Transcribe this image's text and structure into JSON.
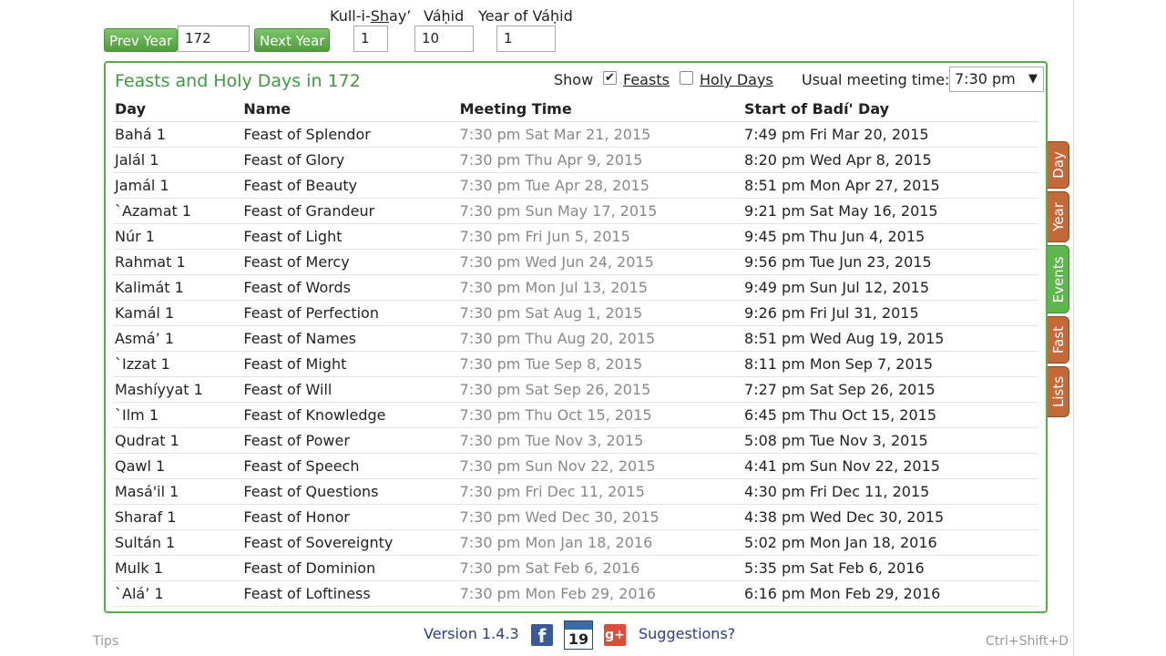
{
  "controls": {
    "prev_year_label": "Prev Year",
    "year_value": "172",
    "next_year_label": "Next Year",
    "kulli_shay_label_a": "Kull-i-",
    "kulli_shay_label_b": "Sh",
    "kulli_shay_label_c": "ay’",
    "kulli_shay_value": "1",
    "vahid_label": "Váḥid",
    "vahid_value": "10",
    "year_of_vahid_label": "Year of Váḥid",
    "year_of_vahid_value": "1"
  },
  "panel": {
    "title": "Feasts and Holy Days in 172",
    "show_label": "Show",
    "feasts_label": "Feasts",
    "feasts_checked": true,
    "holy_days_label": "Holy Days",
    "holy_days_checked": false,
    "meeting_time_label": "Usual meeting time:",
    "meeting_time_value": "7:30 pm"
  },
  "table": {
    "headers": [
      "Day",
      "Name",
      "Meeting Time",
      "Start of Badí' Day"
    ],
    "rows": [
      [
        "Bahá 1",
        "Feast of Splendor",
        "7:30 pm Sat Mar 21, 2015",
        "7:49 pm Fri Mar 20, 2015"
      ],
      [
        "Jalál 1",
        "Feast of Glory",
        "7:30 pm Thu Apr 9, 2015",
        "8:20 pm Wed Apr 8, 2015"
      ],
      [
        "Jamál 1",
        "Feast of Beauty",
        "7:30 pm Tue Apr 28, 2015",
        "8:51 pm Mon Apr 27, 2015"
      ],
      [
        "`Azamat 1",
        "Feast of Grandeur",
        "7:30 pm Sun May 17, 2015",
        "9:21 pm Sat May 16, 2015"
      ],
      [
        "Núr 1",
        "Feast of Light",
        "7:30 pm Fri Jun 5, 2015",
        "9:45 pm Thu Jun 4, 2015"
      ],
      [
        "Rahmat 1",
        "Feast of Mercy",
        "7:30 pm Wed Jun 24, 2015",
        "9:56 pm Tue Jun 23, 2015"
      ],
      [
        "Kalimát 1",
        "Feast of Words",
        "7:30 pm Mon Jul 13, 2015",
        "9:49 pm Sun Jul 12, 2015"
      ],
      [
        "Kamál 1",
        "Feast of Perfection",
        "7:30 pm Sat Aug 1, 2015",
        "9:26 pm Fri Jul 31, 2015"
      ],
      [
        "Asmá’ 1",
        "Feast of Names",
        "7:30 pm Thu Aug 20, 2015",
        "8:51 pm Wed Aug 19, 2015"
      ],
      [
        "`Izzat 1",
        "Feast of Might",
        "7:30 pm Tue Sep 8, 2015",
        "8:11 pm Mon Sep 7, 2015"
      ],
      [
        "Mashíyyat 1",
        "Feast of Will",
        "7:30 pm Sat Sep 26, 2015",
        "7:27 pm Sat Sep 26, 2015"
      ],
      [
        "`Ilm 1",
        "Feast of Knowledge",
        "7:30 pm Thu Oct 15, 2015",
        "6:45 pm Thu Oct 15, 2015"
      ],
      [
        "Qudrat 1",
        "Feast of Power",
        "7:30 pm Tue Nov 3, 2015",
        "5:08 pm Tue Nov 3, 2015"
      ],
      [
        "Qawl 1",
        "Feast of Speech",
        "7:30 pm Sun Nov 22, 2015",
        "4:41 pm Sun Nov 22, 2015"
      ],
      [
        "Masá'il 1",
        "Feast of Questions",
        "7:30 pm Fri Dec 11, 2015",
        "4:30 pm Fri Dec 11, 2015"
      ],
      [
        "Sharaf 1",
        "Feast of Honor",
        "7:30 pm Wed Dec 30, 2015",
        "4:38 pm Wed Dec 30, 2015"
      ],
      [
        "Sultán 1",
        "Feast of Sovereignty",
        "7:30 pm Mon Jan 18, 2016",
        "5:02 pm Mon Jan 18, 2016"
      ],
      [
        "Mulk 1",
        "Feast of Dominion",
        "7:30 pm Sat Feb 6, 2016",
        "5:35 pm Sat Feb 6, 2016"
      ],
      [
        "`Alá’ 1",
        "Feast of Loftiness",
        "7:30 pm Mon Feb 29, 2016",
        "6:16 pm Mon Feb 29, 2016"
      ]
    ]
  },
  "side_tabs": {
    "day": "Day",
    "year": "Year",
    "events": "Events",
    "fast": "Fast",
    "lists": "Lists"
  },
  "footer": {
    "tips": "Tips",
    "version": "Version 1.4.3",
    "calendar_day": "19",
    "suggestions": "Suggestions?",
    "shortcut": "Ctrl+Shift+D"
  },
  "icons": {
    "facebook": "facebook-icon",
    "calendar": "calendar-icon",
    "google_plus": "google-plus-icon"
  },
  "colors": {
    "accent_green": "#57ad47",
    "title_green": "#3f9b3f",
    "tab_brown": "#c46a3a",
    "tab_green": "#5fb64d",
    "link_blue": "#2b3f8a"
  }
}
